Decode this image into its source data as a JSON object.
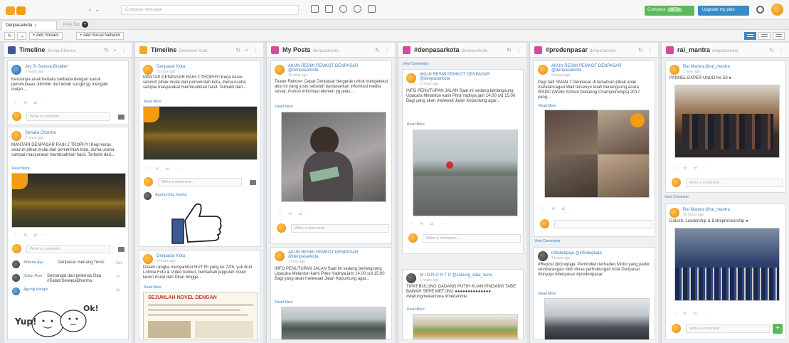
{
  "search": {
    "placeholder": "Compose message"
  },
  "buttons": {
    "compose": "Compose",
    "beta": "BETA",
    "upgrade": "Upgrade my plan"
  },
  "tabs": {
    "active": "Denpasarkota",
    "close": "x",
    "new": "New Tab",
    "add": "+"
  },
  "toolbar": {
    "add_stream": "+ Add Stream",
    "add_network": "+ Add Social Network"
  },
  "columns": [
    {
      "title": "Timeline",
      "sub": "Senaa Dharma",
      "icon_color": "#3b5998",
      "cards": [
        {
          "user": "Joy Si Suseva Brsaker",
          "time": "2 hours ago",
          "text": "Kerusinya anak berlaku berbeda dengan kanuli pemmubaan Jdrmbin dari lebuh sungki yg mengaki inulah....",
          "comment": "Write a comment..."
        },
        {
          "user": "Senaka Dharma",
          "time": "2 hours ago",
          "text": "MANTARI DENPASAR RAIH 2 TROPHY! Kegi keras seluruh pihak mulai dari pemerintah kota, duma usaha sampai masyarakat membuahkan hasil. Terbukti dari...",
          "more": "Read More",
          "comment": "Write a comment...",
          "replies": [
            {
              "user": "Arbena Ayu",
              "text": "Denpasar menang Terus",
              "count": "2km"
            },
            {
              "user": "Sukar Rori",
              "text": "Semangat dan pelemas Daa #SalamSewakaDharma",
              "count": "1k"
            },
            {
              "user": "Agung Kengik",
              "text": "",
              "count": "1k"
            }
          ],
          "sticker": "Yup!",
          "sticker2": "Ok!"
        }
      ]
    },
    {
      "title": "Timeline",
      "sub": "Denpasar Kota",
      "icon_color": "#f5a623",
      "cards": [
        {
          "user": "Denpasar Kota",
          "time": "2 hours ago",
          "text": "MANTAP DENPASAR RAIH 2 TROPHY! Kerja keras seluruh pihak mulai dari pemerintah kota, duma usaha sampai masyarakat membuahkan hasil. Terbukti dari...",
          "more": "Read More",
          "comment": "Write a comment...",
          "liker": "Agung Oka Samia"
        },
        {
          "user": "Denpasar Kota",
          "time": "5 hours ago",
          "text": "Dalam rangka menyambut HUT RI yang ke 72th, yuk ikuti Lomba Foto & Video berikut, berhadiah jeppuluh novel keren mulai dari Dilan hingga...",
          "more": "Read More",
          "poster": "SEJUMLAH NOVEL DENGAN"
        }
      ]
    },
    {
      "title": "My Posts",
      "sub": "denpasarkota",
      "icon_color": "#d64aa0",
      "cards": [
        {
          "user": "AKUN RESMI PEMKOT DENPASAR",
          "handle": "@denpasarkota",
          "time": "35 mins ago",
          "text": "Teater Rekorer Cepat Denpasar bergerak untuk mengeteksi aksi ini yang justu sebelah bardasarkan informasi media sosial, mohon informasi elemen yg jelas...",
          "more": "Read More",
          "comment": "Write a comment..."
        },
        {
          "user": "AKUN RESMI PEMKOT DENPASAR",
          "handle": "@denpasarkota",
          "time": "1 hour ago",
          "text": "INFO PENUTUPAN JALAN Saat ini sedang berlangsung Upacara Melantun kami Piteo Yadnya jam 14.00 s/d 15.00 Bagi yang akan melewaei Jalan Kepuntung agar...",
          "more": "Read More"
        }
      ]
    },
    {
      "title": "#denpasarkota",
      "sub": "denpasarkota",
      "icon_color": "#d64aa0",
      "cards": [
        {
          "user": "AKUN RESMI PEMKOT DENPASAR",
          "handle": "@denpasarkota",
          "time": "1 hours ago",
          "text": "INFO PENUTUPAN JALAN Saat ini sedang berlangsung Upacara Melantun kami Pitra Yadnya jam 14.00 s/d 15.00 Bagi yang akan melewati Jalan Kepuntung agar...",
          "more": "Read More",
          "comment": "Write a comment...",
          "view": "View Comments"
        },
        {
          "user": "M I N R O N T U",
          "handle": "@sukung_kata_sunu",
          "time": "1 hours ago",
          "text": "TIPAT BULUNG GADANG PUTIH KUAH PINDANG TABE BAWAH SEPE METUNU ●●●●●●●●●●●●●● #warungmekantuna #medancite",
          "more": "Read More"
        }
      ]
    },
    {
      "title": "#predenpasar",
      "sub": "denpasarkota",
      "icon_color": "#d64aa0",
      "cards": [
        {
          "user": "AKUN RESMI PEMKOT DENPASAR",
          "handle": "@denpasarkota",
          "time": "5 hours ago",
          "text": "Pagi tadi SMAN 7 Denpasar di lamarkan pihak anak mandancagari Wali tersenyu telah berlangsung acara WSDC (World School Debating Championships) 2017 yang...",
          "more": "Read More",
          "view": "View Comments"
        },
        {
          "user": "infodwbpaje",
          "handle": "@infodugbaje",
          "time": "1 hours ago",
          "text": "#Repost @cloupaja. Pemindieri terhadeo Motol yang parkir sembarangan oleh dinas perhubungan kota Denpasar. #lunyaja #denpasar #predenpasar",
          "more": "Read More"
        }
      ]
    },
    {
      "title": "rai_mantra",
      "sub": "denpasarkota",
      "icon_color": "#d64aa0",
      "cards": [
        {
          "user": "Rai Mantra",
          "handle": "@rai_mantra",
          "time": "1 hour ago",
          "text": "PANNEL EXPER UNUD Ke 50 ●",
          "comment": "Write a comment...",
          "view": "View Comment"
        },
        {
          "user": "Rai Mantra",
          "handle": "@rai_mantra",
          "time": "20 hours ago",
          "text": "Datush, Leadership & Entrepreneurship ●",
          "comment": "Write a comment..."
        }
      ]
    }
  ],
  "colors": {
    "accent": "#3a8ac7",
    "compose": "#5cb85c",
    "brand": "#f5a623",
    "facebook": "#3b5998",
    "instagram": "#d64aa0"
  },
  "icons": [
    "search-icon",
    "camera-icon",
    "thumbs-up-icon",
    "plus-icon",
    "refresh-icon",
    "more-icon"
  ]
}
